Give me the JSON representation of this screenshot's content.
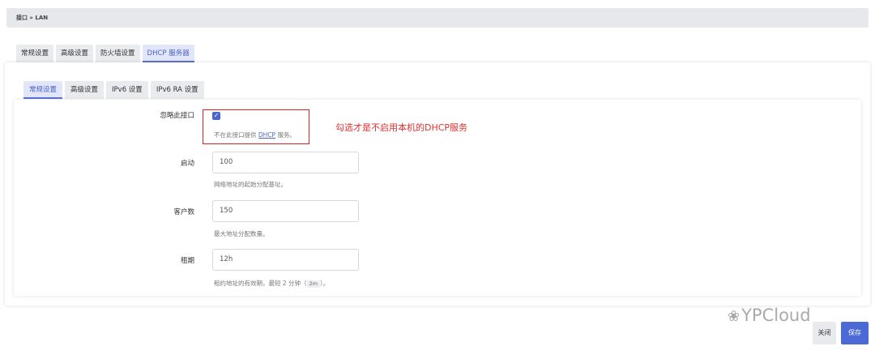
{
  "breadcrumb": "接口 » LAN",
  "tabs_level1": [
    "常规设置",
    "高级设置",
    "防火墙设置",
    "DHCP 服务器"
  ],
  "tabs_level2": [
    "常规设置",
    "高级设置",
    "IPv6 设置",
    "IPv6 RA 设置"
  ],
  "form": {
    "ignore": {
      "label": "忽略此接口",
      "checked": true,
      "check_glyph": "✓",
      "help_prefix": "不在此接口提供 ",
      "help_link": "DHCP",
      "help_suffix": " 服务。"
    },
    "start": {
      "label": "启动",
      "value": "100",
      "help": "网络地址的起始分配基址。"
    },
    "limit": {
      "label": "客户数",
      "value": "150",
      "help": "最大地址分配数量。"
    },
    "lease": {
      "label": "租期",
      "value": "12h",
      "help_prefix": "租约地址的有效期，最短 2 分钟（",
      "help_code": "2m",
      "help_suffix": "）。"
    }
  },
  "annotation": "勾选才是不启用本机的DHCP服务",
  "watermark": {
    "icon": "wechat-icon",
    "glyph": "❀",
    "text": "YPCloud"
  },
  "buttons": {
    "close": "关闭",
    "save": "保存"
  },
  "colors": {
    "accent": "#4c6ad6",
    "annotation_red": "#e02020"
  }
}
